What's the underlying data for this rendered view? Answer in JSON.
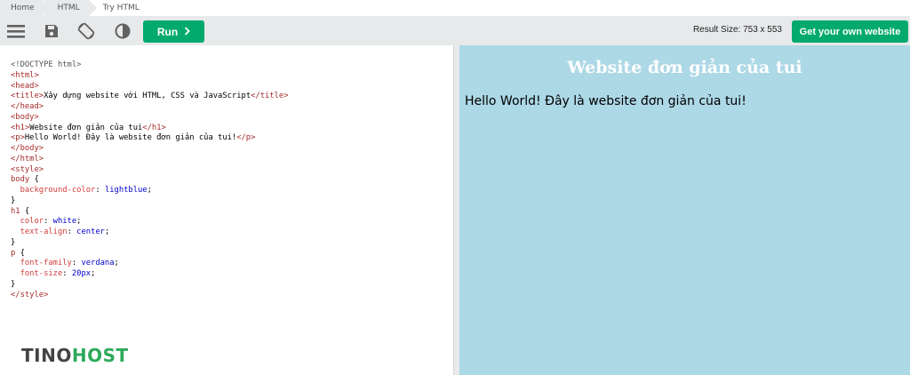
{
  "breadcrumb": [
    "Home",
    "HTML",
    "Try HTML"
  ],
  "toolbar": {
    "icons": [
      "menu-icon",
      "save-icon",
      "rotate-icon",
      "contrast-icon"
    ],
    "run_label": "Run",
    "result_size_label": "Result Size: 753 x 553",
    "own_website_label": "Get your own website"
  },
  "editor": {
    "lines": [
      [
        {
          "t": "<!DOCTYPE html>",
          "c": "doc"
        }
      ],
      [
        {
          "t": "<html>",
          "c": "tag"
        }
      ],
      [
        {
          "t": "<head>",
          "c": "tag"
        }
      ],
      [
        {
          "t": "<title>",
          "c": "tag"
        },
        {
          "t": "Xây dựng website với HTML, CSS và JavaScript",
          "c": "txt"
        },
        {
          "t": "</title>",
          "c": "tag"
        }
      ],
      [
        {
          "t": "</head>",
          "c": "tag"
        }
      ],
      [
        {
          "t": "<body>",
          "c": "tag"
        }
      ],
      [
        {
          "t": "<h1>",
          "c": "tag"
        },
        {
          "t": "Website đơn giản của tui",
          "c": "txt"
        },
        {
          "t": "</h1>",
          "c": "tag"
        }
      ],
      [
        {
          "t": "<p>",
          "c": "tag"
        },
        {
          "t": "Hello World! Đây là website đơn giản của tui!",
          "c": "txt"
        },
        {
          "t": "</p>",
          "c": "tag"
        }
      ],
      [
        {
          "t": "</body>",
          "c": "tag"
        }
      ],
      [
        {
          "t": "</html>",
          "c": "tag"
        }
      ],
      [
        {
          "t": "<style>",
          "c": "tag"
        }
      ],
      [
        {
          "t": "body",
          "c": "sel"
        },
        {
          "t": " {",
          "c": "punc"
        }
      ],
      [
        {
          "t": "  background-color",
          "c": "prop"
        },
        {
          "t": ": ",
          "c": "punc"
        },
        {
          "t": "lightblue",
          "c": "val"
        },
        {
          "t": ";",
          "c": "punc"
        }
      ],
      [
        {
          "t": "}",
          "c": "punc"
        }
      ],
      [
        {
          "t": "h1",
          "c": "sel"
        },
        {
          "t": " {",
          "c": "punc"
        }
      ],
      [
        {
          "t": "  color",
          "c": "prop"
        },
        {
          "t": ": ",
          "c": "punc"
        },
        {
          "t": "white",
          "c": "val"
        },
        {
          "t": ";",
          "c": "punc"
        }
      ],
      [
        {
          "t": "  text-align",
          "c": "prop"
        },
        {
          "t": ": ",
          "c": "punc"
        },
        {
          "t": "center",
          "c": "val"
        },
        {
          "t": ";",
          "c": "punc"
        }
      ],
      [
        {
          "t": "}",
          "c": "punc"
        }
      ],
      [
        {
          "t": "p",
          "c": "sel"
        },
        {
          "t": " {",
          "c": "punc"
        }
      ],
      [
        {
          "t": "  font-family",
          "c": "prop"
        },
        {
          "t": ": ",
          "c": "punc"
        },
        {
          "t": "verdana",
          "c": "val"
        },
        {
          "t": ";",
          "c": "punc"
        }
      ],
      [
        {
          "t": "  font-size",
          "c": "prop"
        },
        {
          "t": ": ",
          "c": "punc"
        },
        {
          "t": "20px",
          "c": "val"
        },
        {
          "t": ";",
          "c": "punc"
        }
      ],
      [
        {
          "t": "}",
          "c": "punc"
        }
      ],
      [
        {
          "t": "</style>",
          "c": "tag"
        }
      ]
    ]
  },
  "logo": {
    "part1": "TINO",
    "part2": "HOST"
  },
  "result": {
    "heading": "Website đơn giản của tui",
    "paragraph": "Hello World! Đây là website đơn giản của tui!"
  },
  "colors": {
    "accent": "#04aa6d",
    "toolbar_bg": "#e7e9eb",
    "result_bg": "#add8e6",
    "logo_green": "#2eaa5c"
  }
}
